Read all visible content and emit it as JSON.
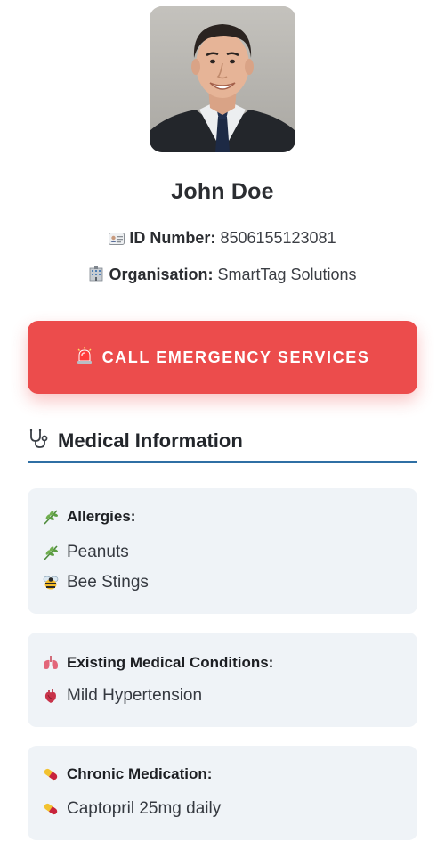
{
  "profile": {
    "name": "John Doe",
    "id_label": "ID Number:",
    "id_value": "8506155123081",
    "org_label": "Organisation:",
    "org_value": "SmartTag Solutions",
    "id_icon": "id-card-icon",
    "org_icon": "office-building-icon"
  },
  "emergency": {
    "label": "CALL EMERGENCY SERVICES",
    "icon": "siren-icon",
    "color": "#ec4c4c"
  },
  "medical": {
    "title": "Medical Information",
    "icon": "stethoscope-icon",
    "accent": "#2f6fa4",
    "allergies": {
      "title": "Allergies:",
      "icon": "herb-icon",
      "items": [
        {
          "label": "Peanuts",
          "icon": "herb-icon"
        },
        {
          "label": "Bee Stings",
          "icon": "bee-icon"
        }
      ]
    },
    "conditions": {
      "title": "Existing Medical Conditions:",
      "icon": "lungs-icon",
      "items": [
        {
          "label": "Mild Hypertension",
          "icon": "anatomical-heart-icon"
        }
      ]
    },
    "medication": {
      "title": "Chronic Medication:",
      "icon": "pill-icon",
      "items": [
        {
          "label": "Captopril 25mg daily",
          "icon": "pill-icon"
        }
      ]
    }
  }
}
